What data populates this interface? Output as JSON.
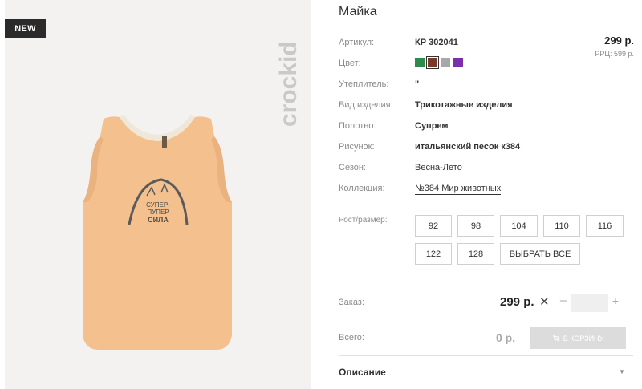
{
  "product": {
    "badge": "NEW",
    "brand": "crockid",
    "print_text": [
      "СУПЕР-",
      "ПУПЕР",
      "СИЛА"
    ],
    "title": "Майка"
  },
  "attributes": [
    {
      "label": "Артикул:",
      "value": "КР 302041"
    },
    {
      "label": "Цвет:",
      "value": ""
    },
    {
      "label": "Утеплитель:",
      "value": "\""
    },
    {
      "label": "Вид изделия:",
      "value": "Трикотажные изделия"
    },
    {
      "label": "Полотно:",
      "value": "Супрем"
    },
    {
      "label": "Рисунок:",
      "value": "итальянский песок к384"
    },
    {
      "label": "Сезон:",
      "value": "Весна-Лето"
    },
    {
      "label": "Коллекция:",
      "value": "№384 Мир животных"
    }
  ],
  "colors": [
    {
      "name": "green",
      "hex": "#2f8a4e"
    },
    {
      "name": "brown",
      "hex": "#7a3a2a",
      "selected": true
    },
    {
      "name": "gray",
      "hex": "#a8a8a8"
    },
    {
      "name": "purple",
      "hex": "#7b2fa8"
    }
  ],
  "pricing": {
    "price": "299 р.",
    "rrp": "РРЦ: 599 р."
  },
  "sizes": {
    "label": "Рост/размер:",
    "options": [
      "92",
      "98",
      "104",
      "110",
      "116",
      "122",
      "128"
    ],
    "select_all": "ВЫБРАТЬ ВСЕ"
  },
  "order": {
    "label": "Заказ:",
    "price": "299 р.",
    "remove_symbol": "✕",
    "minus": "–",
    "quantity": "",
    "plus": "+"
  },
  "total": {
    "label": "Всего:",
    "value": "0 р.",
    "cart_button": "В КОРЗИНУ"
  },
  "description": {
    "label": "Описание"
  },
  "icons": {
    "cart": "cart-icon",
    "caret": "chevron-down-icon"
  }
}
